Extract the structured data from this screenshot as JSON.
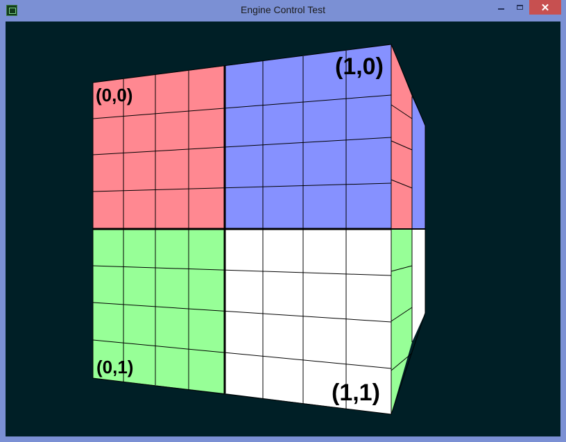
{
  "window": {
    "title": "Engine Control Test",
    "icon": "app-icon",
    "controls": {
      "minimize_icon": "minimize-icon",
      "maximize_icon": "maximize-icon",
      "close_glyph": "✕"
    }
  },
  "scene": {
    "background_color": "#001f26",
    "front_face": {
      "quadrants": [
        {
          "label": "(0,0)",
          "color": "#ff8891"
        },
        {
          "label": "(1,0)",
          "color": "#8691ff"
        },
        {
          "label": "(0,1)",
          "color": "#97ff97"
        },
        {
          "label": "(1,1)",
          "color": "#ffffff"
        }
      ]
    },
    "side_face": {
      "colors": [
        "#ff8891",
        "#8691ff",
        "#97ff97",
        "#ffffff"
      ]
    }
  }
}
